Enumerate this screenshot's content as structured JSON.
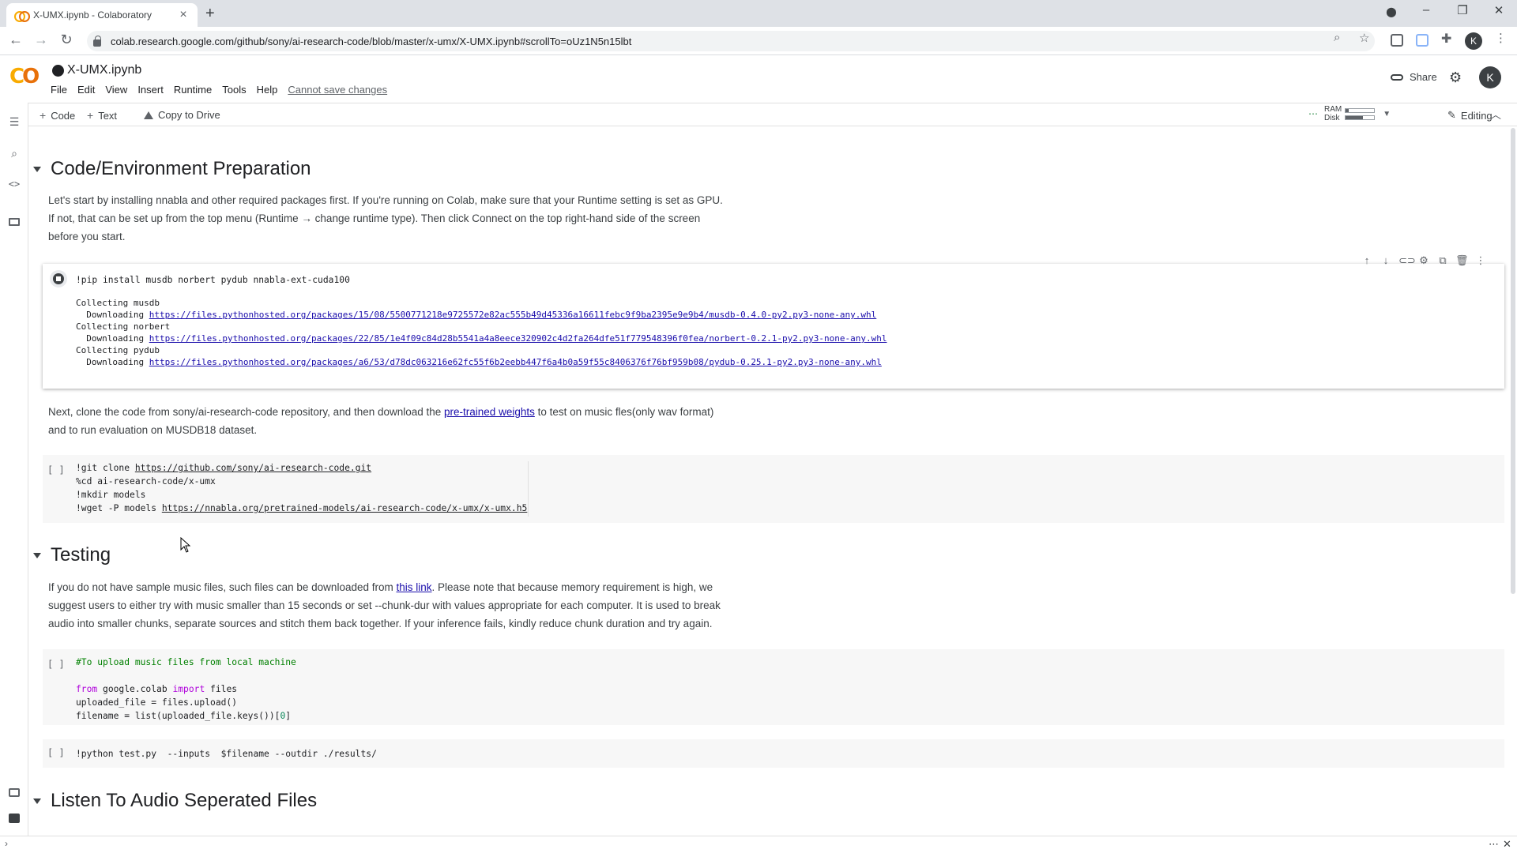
{
  "browser": {
    "tab_title": "X-UMX.ipynb - Colaboratory",
    "url": "colab.research.google.com/github/sony/ai-research-code/blob/master/x-umx/X-UMX.ipynb#scrollTo=oUz1N5n15lbt",
    "profile_initial": "K"
  },
  "colab": {
    "notebook_title": "X-UMX.ipynb",
    "menu": [
      "File",
      "Edit",
      "View",
      "Insert",
      "Runtime",
      "Tools",
      "Help"
    ],
    "cannot_save": "Cannot save changes",
    "share_label": "Share",
    "avatar_initial": "K"
  },
  "toolbar": {
    "code_label": "Code",
    "text_label": "Text",
    "copy_to_drive": "Copy to Drive",
    "ram_label": "RAM",
    "disk_label": "Disk",
    "ram_usage": 0.1,
    "disk_usage": 0.6,
    "editing_label": "Editing"
  },
  "notebook": {
    "section1": {
      "title": "Code/Environment Preparation",
      "intro_line1": "Let's start by installing nnabla and other required packages first. If you're running on Colab, make sure that your Runtime setting is set as GPU.",
      "intro_line2": "If not, that can be set up from the top menu (Runtime → change runtime type). Then click Connect on the top right-hand side of the screen",
      "intro_line3": "before you start.",
      "pip_cell": "!pip install musdb norbert pydub nnabla-ext-cuda100",
      "output": {
        "l1": "Collecting musdb",
        "l2_prefix": "  Downloading ",
        "l2_link": "https://files.pythonhosted.org/packages/15/08/5500771218e9725572e82ac555b49d45336a16611febc9f9ba2395e9e9b4/musdb-0.4.0-py2.py3-none-any.whl",
        "l3": "Collecting norbert",
        "l4_prefix": "  Downloading ",
        "l4_link": "https://files.pythonhosted.org/packages/22/85/1e4f09c84d28b5541a4a8eece320902c4d2fa264dfe51f779548396f0fea/norbert-0.2.1-py2.py3-none-any.whl",
        "l5": "Collecting pydub",
        "l6_prefix": "  Downloading ",
        "l6_link": "https://files.pythonhosted.org/packages/a6/53/d78dc063216e62fc55f6b2eebb447f6a4b0a59f55c8406376f76bf959b08/pydub-0.25.1-py2.py3-none-any.whl"
      },
      "clone_text_prefix": "Next, clone the code from sony/ai-research-code repository, and then download the ",
      "clone_text_link": "pre-trained weights",
      "clone_text_suffix": " to test on music fles(only wav format)",
      "clone_text_line2": "and to run evaluation on MUSDB18 dataset.",
      "git_cell": {
        "l1_prefix": "!git clone ",
        "l1_link": "https://github.com/sony/ai-research-code.git",
        "l2": "%cd ai-research-code/x-umx",
        "l3": "!mkdir models",
        "l4_prefix": "!wget -P models ",
        "l4_link": "https://nnabla.org/pretrained-models/ai-research-code/x-umx/x-umx.h5"
      }
    },
    "section2": {
      "title": "Testing",
      "para_l1_prefix": "If you do not have sample music files, such files can be downloaded from ",
      "para_l1_link": "this link",
      "para_l1_suffix": ". Please note that because memory requirement is high, we",
      "para_l2": "suggest users to either try with music smaller than 15 seconds or set --chunk-dur with values appropriate for each computer. It is used to break",
      "para_l3": "audio into smaller chunks, separate sources and stitch them back together. If your inference fails, kindly reduce chunk duration and try again.",
      "upload_cell": {
        "comment": "#To upload music files from local machine",
        "l2_kw1": "from",
        "l2_mid": " google.colab ",
        "l2_kw2": "import",
        "l2_end": " files",
        "l3": "uploaded_file = files.upload()",
        "l4_prefix": "filename = list(uploaded_file.keys())[",
        "l4_num": "0",
        "l4_suffix": "]"
      },
      "test_cell": "!python test.py  --inputs  $filename --outdir ./results/"
    },
    "section3": {
      "title": "Listen To Audio Seperated Files"
    },
    "empty_gutter": "[ ]"
  }
}
